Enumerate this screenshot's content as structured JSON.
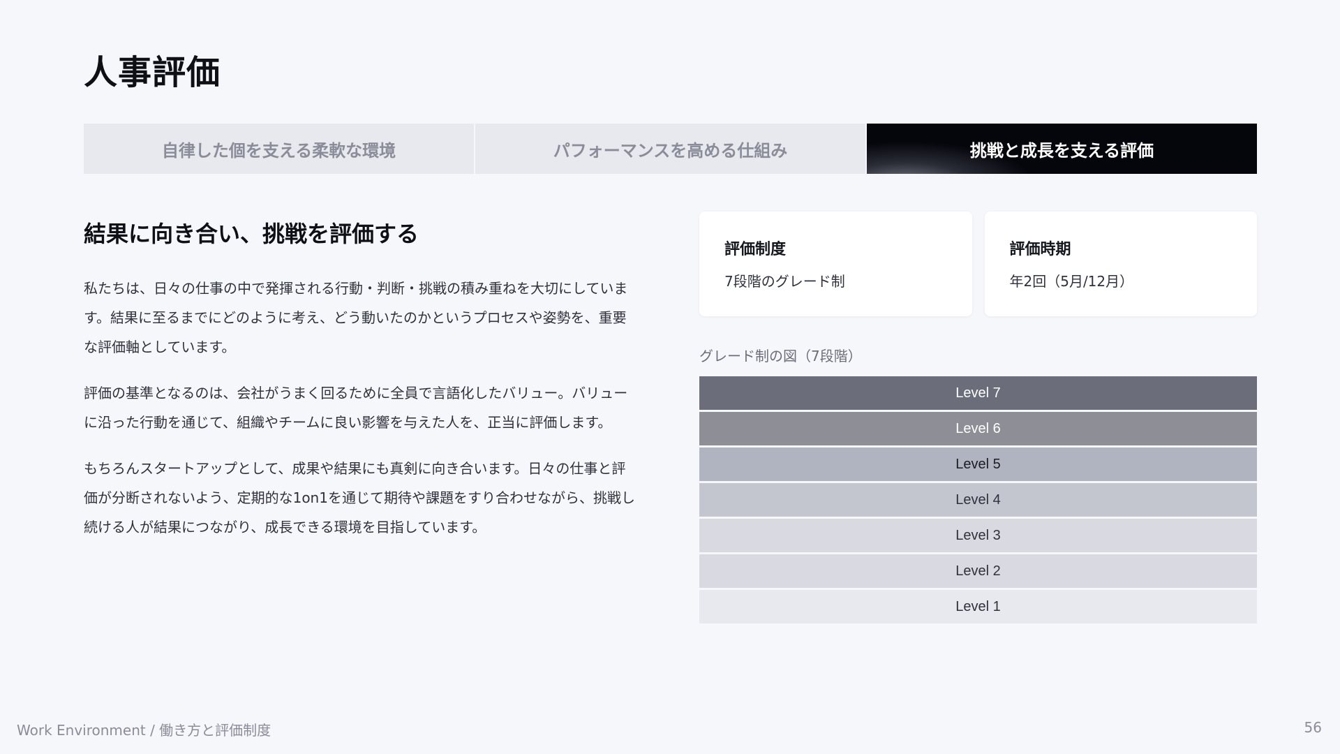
{
  "title": "人事評価",
  "tabs": [
    {
      "label": "自律した個を支える柔軟な環境",
      "active": false
    },
    {
      "label": "パフォーマンスを高める仕組み",
      "active": false
    },
    {
      "label": "挑戦と成長を支える評価",
      "active": true
    }
  ],
  "section": {
    "heading": "結果に向き合い、挑戦を評価する",
    "paragraphs": [
      "私たちは、日々の仕事の中で発揮される行動・判断・挑戦の積み重ねを大切にしています。結果に至るまでにどのように考え、どう動いたのかというプロセスや姿勢を、重要な評価軸としています。",
      "評価の基準となるのは、会社がうまく回るために全員で言語化したバリュー。バリューに沿った行動を通じて、組織やチームに良い影響を与えた人を、正当に評価します。",
      "もちろんスタートアップとして、成果や結果にも真剣に向き合います。日々の仕事と評価が分断されないよう、定期的な1on1を通じて期待や課題をすり合わせながら、挑戦し続ける人が結果につながり、成長できる環境を目指しています。"
    ]
  },
  "cards": [
    {
      "title": "評価制度",
      "value": "7段階のグレード制"
    },
    {
      "title": "評価時期",
      "value": "年2回（5月/12月）"
    }
  ],
  "grade": {
    "label": "グレード制の図（7段階）",
    "levels": [
      {
        "label": "Level 7",
        "bg": "#6b6d7a",
        "fg": "#ffffff"
      },
      {
        "label": "Level 6",
        "bg": "#8e8f96",
        "fg": "#ffffff"
      },
      {
        "label": "Level 5",
        "bg": "#b0b3c0",
        "fg": "#1b1d24"
      },
      {
        "label": "Level 4",
        "bg": "#c3c5cf",
        "fg": "#2f323c"
      },
      {
        "label": "Level 3",
        "bg": "#d9dae1",
        "fg": "#2f323c"
      },
      {
        "label": "Level 2",
        "bg": "#d9dae1",
        "fg": "#2f323c"
      },
      {
        "label": "Level 1",
        "bg": "#e8e9ee",
        "fg": "#2f323c"
      }
    ]
  },
  "footer": {
    "breadcrumb": "Work Environment / 働き方と評価制度",
    "page_number": "56"
  }
}
